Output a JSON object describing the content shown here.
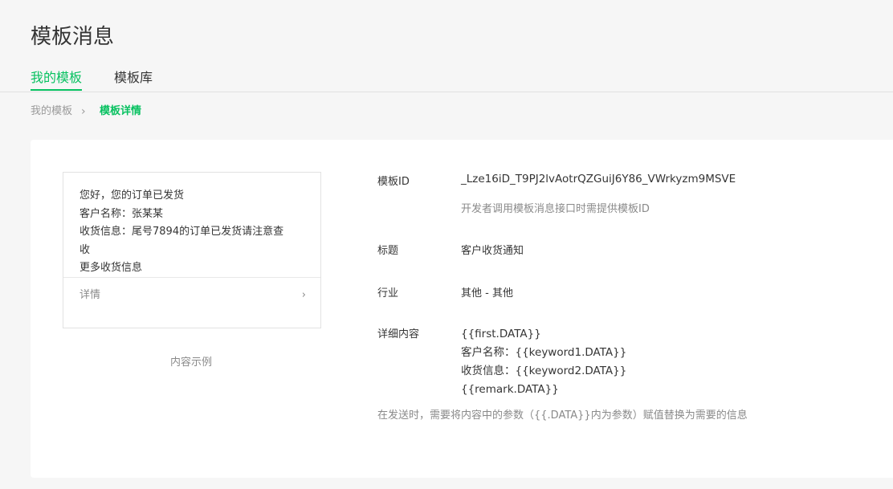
{
  "page": {
    "title": "模板消息"
  },
  "tabs": [
    {
      "label": "我的模板",
      "active": true
    },
    {
      "label": "模板库",
      "active": false
    }
  ],
  "breadcrumb": {
    "parent": "我的模板",
    "separator": "›",
    "current": "模板详情"
  },
  "preview": {
    "lines": [
      "您好，您的订单已发货",
      "客户名称：张某某",
      "收货信息：尾号7894的订单已发货请注意查",
      "收",
      "更多收货信息"
    ],
    "footer_label": "详情",
    "footer_arrow": "›",
    "caption": "内容示例"
  },
  "detail": {
    "template_id": {
      "label": "模板ID",
      "value": "_Lze16iD_T9PJ2lvAotrQZGuiJ6Y86_VWrkyzm9MSVE",
      "hint": "开发者调用模板消息接口时需提供模板ID"
    },
    "title": {
      "label": "标题",
      "value": "客户收货通知"
    },
    "industry": {
      "label": "行业",
      "value": "其他 - 其他"
    },
    "content": {
      "label": "详细内容",
      "lines": [
        "{{first.DATA}}",
        "客户名称：{{keyword1.DATA}}",
        "收货信息：{{keyword2.DATA}}",
        "{{remark.DATA}}"
      ],
      "note": "在发送时，需要将内容中的参数（{{.DATA}}内为参数）赋值替换为需要的信息"
    }
  },
  "colors": {
    "accent": "#07c160",
    "text": "#353535",
    "muted": "#8a8a8a",
    "background": "#f6f6f6",
    "panel": "#ffffff"
  }
}
